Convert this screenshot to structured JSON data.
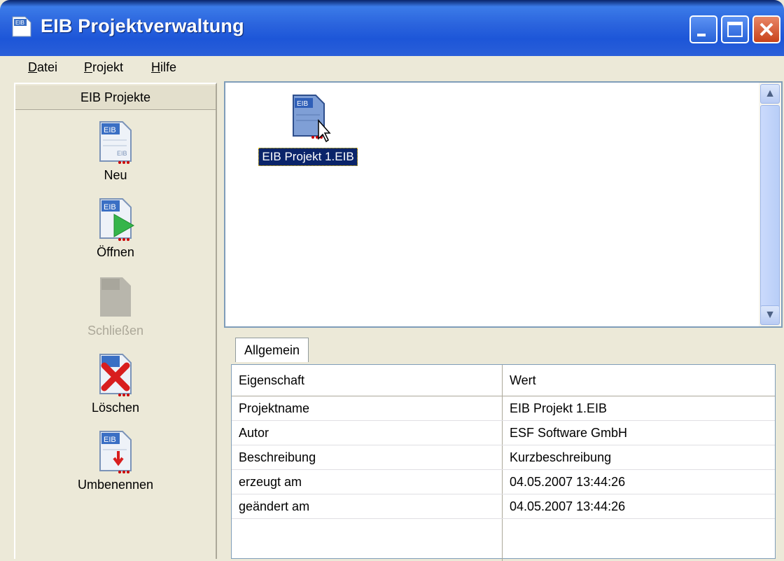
{
  "window": {
    "title": "EIB Projektverwaltung",
    "app_icon_text": "EIB"
  },
  "menu": {
    "items": [
      {
        "underline": "D",
        "rest": "atei"
      },
      {
        "underline": "P",
        "rest": "rojekt"
      },
      {
        "underline": "H",
        "rest": "ilfe"
      }
    ]
  },
  "sidebar": {
    "header": "EIB Projekte",
    "tools": [
      {
        "label": "Neu",
        "enabled": true,
        "icon": "new-project-icon"
      },
      {
        "label": "Öffnen",
        "enabled": true,
        "icon": "open-project-icon"
      },
      {
        "label": "Schließen",
        "enabled": false,
        "icon": "close-project-icon"
      },
      {
        "label": "Löschen",
        "enabled": true,
        "icon": "delete-project-icon"
      },
      {
        "label": "Umbenennen",
        "enabled": true,
        "icon": "rename-project-icon"
      }
    ]
  },
  "files": {
    "items": [
      {
        "name": "EIB Projekt 1.EIB",
        "selected": true
      }
    ]
  },
  "properties": {
    "tab": "Allgemein",
    "columns": [
      "Eigenschaft",
      "Wert"
    ],
    "rows": [
      [
        "Projektname",
        "EIB Projekt 1.EIB"
      ],
      [
        "Autor",
        "ESF Software GmbH"
      ],
      [
        "Beschreibung",
        "Kurzbeschreibung"
      ],
      [
        "erzeugt am",
        "04.05.2007 13:44:26"
      ],
      [
        "geändert am",
        "04.05.2007 13:44:26"
      ]
    ]
  },
  "colors": {
    "titlebar": "#2A63DD",
    "selection": "#0A246A",
    "window_bg": "#ECE9D8"
  }
}
